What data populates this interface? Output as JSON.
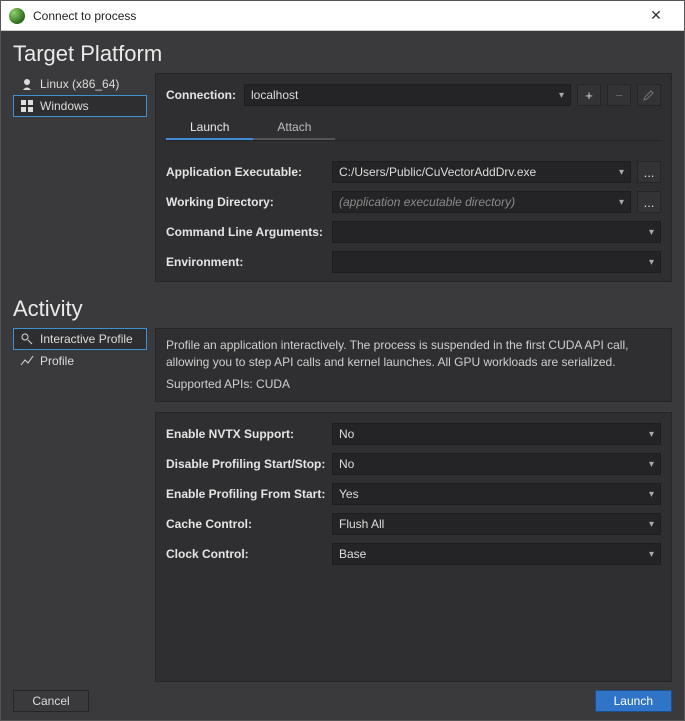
{
  "window": {
    "title": "Connect to process"
  },
  "target_platform": {
    "heading": "Target Platform",
    "items": [
      {
        "label": "Linux (x86_64)",
        "icon": "linux"
      },
      {
        "label": "Windows",
        "icon": "windows"
      }
    ],
    "selected_index": 1,
    "connection": {
      "label": "Connection:",
      "value": "localhost"
    },
    "tabs": [
      {
        "label": "Launch"
      },
      {
        "label": "Attach"
      }
    ],
    "active_tab_index": 0,
    "fields": {
      "app_exe": {
        "label": "Application Executable:",
        "value": "C:/Users/Public/CuVectorAddDrv.exe"
      },
      "work_dir": {
        "label": "Working Directory:",
        "placeholder": "(application executable directory)"
      },
      "cmd_args": {
        "label": "Command Line Arguments:",
        "value": ""
      },
      "env": {
        "label": "Environment:",
        "value": ""
      }
    }
  },
  "activity": {
    "heading": "Activity",
    "items": [
      {
        "label": "Interactive Profile"
      },
      {
        "label": "Profile"
      }
    ],
    "selected_index": 0,
    "description": "Profile an application interactively. The process is suspended in the first CUDA API call, allowing you to step API calls and kernel launches. All GPU workloads are serialized.",
    "supported_apis": "Supported APIs: CUDA",
    "options": {
      "nvtx": {
        "label": "Enable NVTX Support:",
        "value": "No"
      },
      "disable": {
        "label": "Disable Profiling Start/Stop:",
        "value": "No"
      },
      "enable": {
        "label": "Enable Profiling From Start:",
        "value": "Yes"
      },
      "cache": {
        "label": "Cache Control:",
        "value": "Flush All"
      },
      "clock": {
        "label": "Clock Control:",
        "value": "Base"
      }
    }
  },
  "buttons": {
    "cancel": "Cancel",
    "launch": "Launch",
    "ellipsis": "...",
    "plus": "+",
    "minus": "−"
  }
}
